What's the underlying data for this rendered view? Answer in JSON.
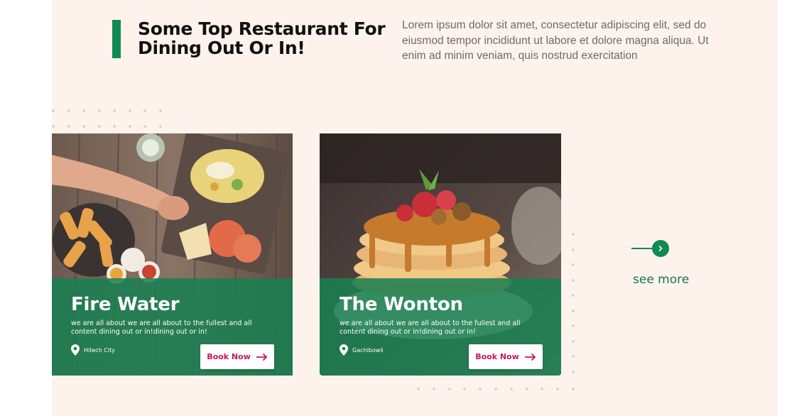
{
  "section": {
    "heading_line1": "Some Top Restaurant For",
    "heading_line2": "Dining Out Or In!",
    "intro": "Lorem ipsum dolor sit amet, consectetur adipiscing elit, sed do eiusmod tempor incididunt ut labore et dolore magna aliqua. Ut enim ad minim veniam, quis nostrud exercitation",
    "accent_color": "#0f8a52",
    "background_color": "#fdf3ec"
  },
  "cards": [
    {
      "title": "Fire Water",
      "description": "we are all about we are all about to the fullest and all content dining out or in!dining out or in!",
      "location": "Hitech City",
      "location_icon": "map-pin-icon",
      "button_label": "Book Now",
      "button_icon": "arrow-right-icon",
      "image": "table with fries, salad and drinks"
    },
    {
      "title": "The Wonton",
      "description": "we are all about we are all about to the fullest and all content dining out or in!dining out or in!",
      "location": "Gachibowli",
      "location_icon": "map-pin-icon",
      "button_label": "Book Now",
      "button_icon": "arrow-right-icon",
      "image": "pancake stack with caramel and strawberries"
    }
  ],
  "see_more": {
    "label": "see more",
    "icon": "chevron-right-icon"
  },
  "colors": {
    "overlay_green": "#188052",
    "button_text": "#c2185b"
  }
}
